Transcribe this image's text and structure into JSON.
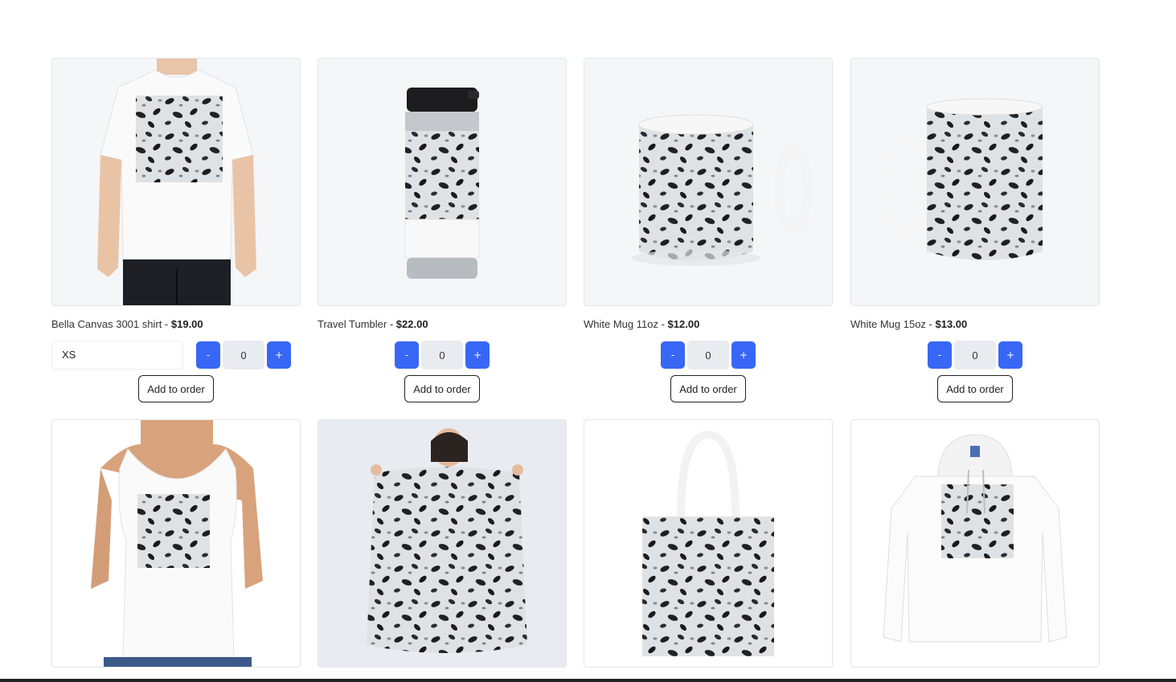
{
  "products": [
    {
      "name": "Bella Canvas 3001 shirt",
      "sep": " - ",
      "price": "$19.00",
      "size": "XS",
      "qty": "0",
      "minus": "-",
      "plus": "+",
      "add_label": "Add to order",
      "image": "tshirt-model-image"
    },
    {
      "name": "Travel Tumbler",
      "sep": " - ",
      "price": "$22.00",
      "qty": "0",
      "minus": "-",
      "plus": "+",
      "add_label": "Add to order",
      "image": "tumbler-image"
    },
    {
      "name": "White Mug 11oz",
      "sep": " - ",
      "price": "$12.00",
      "qty": "0",
      "minus": "-",
      "plus": "+",
      "add_label": "Add to order",
      "image": "mug-11oz-image"
    },
    {
      "name": "White Mug 15oz",
      "sep": " - ",
      "price": "$13.00",
      "qty": "0",
      "minus": "-",
      "plus": "+",
      "add_label": "Add to order",
      "image": "mug-15oz-image"
    },
    {
      "image": "tank-top-image"
    },
    {
      "image": "blanket-image"
    },
    {
      "image": "tote-bag-image"
    },
    {
      "image": "hoodie-image"
    }
  ]
}
